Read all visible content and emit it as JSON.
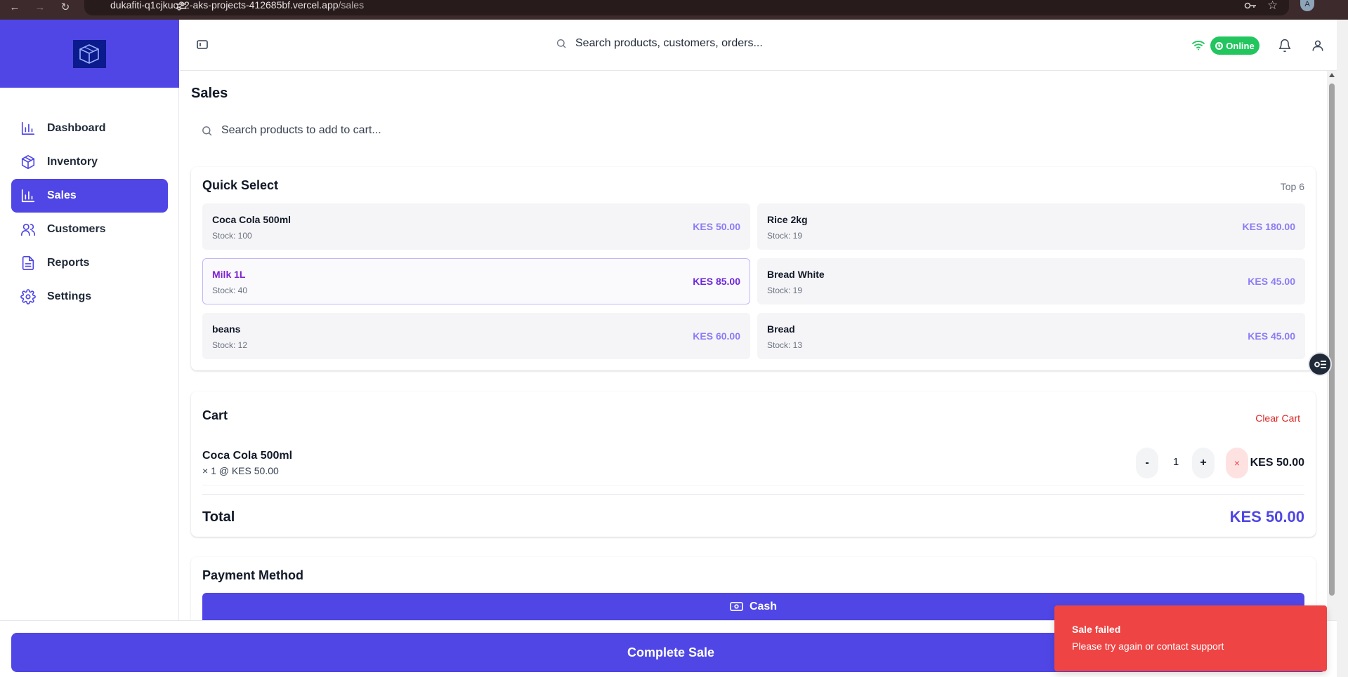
{
  "browser": {
    "url_host": "dukafiti-q1cjkuo22-aks-projects-412685bf.vercel.app",
    "url_path": "/sales",
    "profile_initial": "A"
  },
  "sidebar": {
    "items": [
      {
        "label": "Dashboard",
        "icon": "bar-chart-icon",
        "active": false
      },
      {
        "label": "Inventory",
        "icon": "box-icon",
        "active": false
      },
      {
        "label": "Sales",
        "icon": "bar-chart-icon",
        "active": true
      },
      {
        "label": "Customers",
        "icon": "users-icon",
        "active": false
      },
      {
        "label": "Reports",
        "icon": "file-text-icon",
        "active": false
      },
      {
        "label": "Settings",
        "icon": "gear-icon",
        "active": false
      }
    ]
  },
  "topbar": {
    "search_placeholder": "Search products, customers, orders...",
    "status": "Online"
  },
  "page": {
    "title": "Sales",
    "cart_search_placeholder": "Search products to add to cart..."
  },
  "quick_select": {
    "title": "Quick Select",
    "badge": "Top 6",
    "products": [
      {
        "name": "Coca Cola 500ml",
        "stock": "Stock: 100",
        "price": "KES 50.00",
        "selected": false
      },
      {
        "name": "Rice 2kg",
        "stock": "Stock: 19",
        "price": "KES 180.00",
        "selected": false
      },
      {
        "name": "Milk 1L",
        "stock": "Stock: 40",
        "price": "KES 85.00",
        "selected": true
      },
      {
        "name": "Bread White",
        "stock": "Stock: 19",
        "price": "KES 45.00",
        "selected": false
      },
      {
        "name": "beans",
        "stock": "Stock: 12",
        "price": "KES 60.00",
        "selected": false
      },
      {
        "name": "Bread",
        "stock": "Stock: 13",
        "price": "KES 45.00",
        "selected": false
      }
    ]
  },
  "cart": {
    "title": "Cart",
    "clear_label": "Clear Cart",
    "items": [
      {
        "name": "Coca Cola 500ml",
        "sub": "× 1 @ KES 50.00",
        "qty": "1",
        "minus": "-",
        "plus": "+",
        "remove": "×",
        "line_total": "KES 50.00"
      }
    ],
    "total_label": "Total",
    "total_value": "KES 50.00"
  },
  "payment": {
    "title": "Payment Method",
    "selected_method": "Cash"
  },
  "actions": {
    "complete_label": "Complete Sale"
  },
  "toast": {
    "title": "Sale failed",
    "message": "Please try again or contact support"
  },
  "colors": {
    "primary": "#4f46e5",
    "online": "#22c55e",
    "error": "#ef4444",
    "price": "#8b7cf6"
  }
}
